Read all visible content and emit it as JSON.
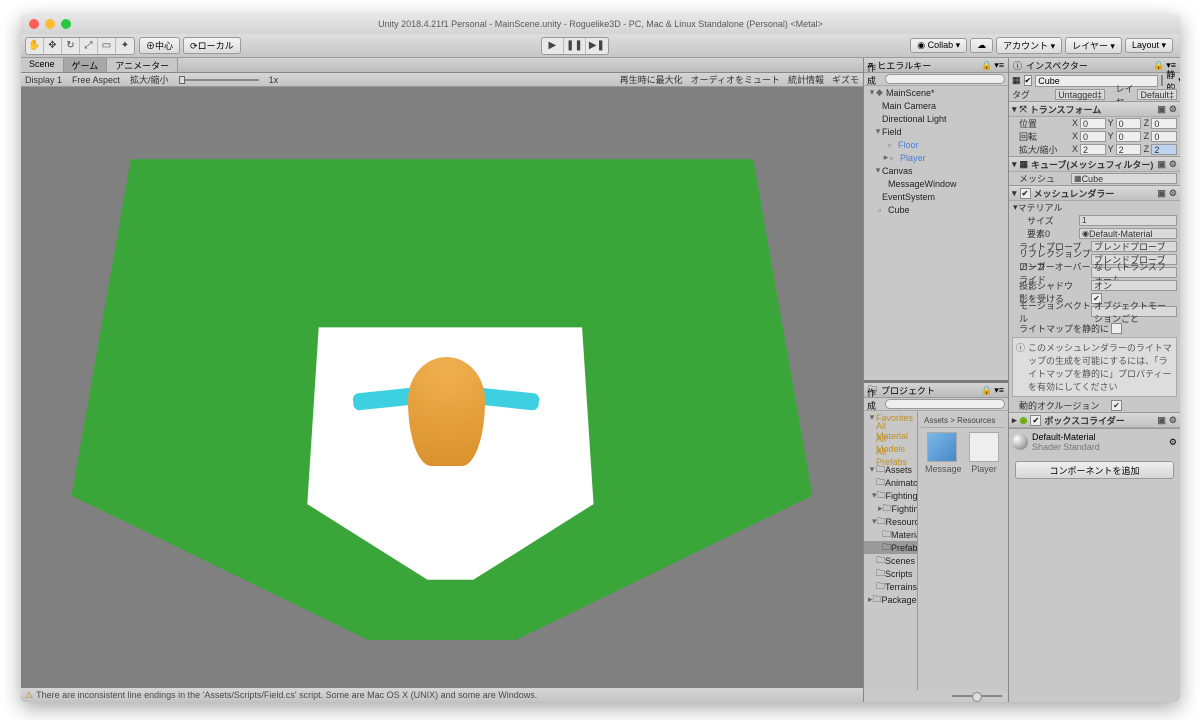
{
  "title": "Unity 2018.4.21f1 Personal - MainScene.unity - Roguelike3D - PC, Mac & Linux Standalone (Personal) <Metal>",
  "toolbar": {
    "center": "中心",
    "local": "ローカル",
    "collab": "Collab",
    "account": "アカウント",
    "layer": "レイヤー",
    "layout": "Layout"
  },
  "tabs": {
    "scene": "Scene",
    "game": "ゲーム",
    "animator": "アニメーター"
  },
  "gamebar": {
    "display": "Display 1",
    "aspect": "Free Aspect",
    "scale_label": "拡大/縮小",
    "scale_val": "1x",
    "maximize": "再生時に最大化",
    "mute": "オーディオをミュート",
    "stats": "統計情報",
    "gizmos": "ギズモ"
  },
  "status": "There are inconsistent line endings in the 'Assets/Scripts/Field.cs' script. Some are Mac OS X (UNIX) and some are Windows.",
  "hierarchy": {
    "title": "ヒエラルキー",
    "create": "作成",
    "scene": "MainScene*",
    "items": [
      "Main Camera",
      "Directional Light",
      "Field",
      "Floor",
      "Player",
      "Canvas",
      "MessageWindow",
      "EventSystem",
      "Cube"
    ]
  },
  "project": {
    "title": "プロジェクト",
    "create": "作成",
    "favorites": "Favorites",
    "fav_items": [
      "All Material",
      "All Models",
      "All Prefabs"
    ],
    "breadcrumb": "Assets > Resources",
    "tree": [
      "Assets",
      "AnimatorCo",
      "FightingUni",
      "FightingU",
      "Resources",
      "Materials",
      "Prefabs",
      "Scenes",
      "Scripts",
      "Terrains",
      "Packages"
    ],
    "assets": [
      {
        "name": "Message"
      },
      {
        "name": "Player"
      }
    ]
  },
  "inspector": {
    "title": "インスペクター",
    "name": "Cube",
    "static": "静的",
    "tag_label": "タグ",
    "tag": "Untagged",
    "layer_label": "レイヤー",
    "layer": "Default",
    "transform": {
      "title": "トランスフォーム",
      "pos": "位置",
      "rot": "回転",
      "scale": "拡大/縮小",
      "px": "0",
      "py": "0",
      "pz": "0",
      "rx": "0",
      "ry": "0",
      "rz": "0",
      "sx": "2",
      "sy": "2",
      "sz": "2"
    },
    "meshfilter": {
      "title": "キューブ(メッシュフィルター)",
      "mesh_label": "メッシュ",
      "mesh": "Cube"
    },
    "meshrenderer": {
      "title": "メッシュレンダラー",
      "materials": "マテリアル",
      "size_label": "サイズ",
      "size": "1",
      "elem": "要素0",
      "mat": "Default-Material",
      "lightprobe_label": "ライトプローブ",
      "lightprobe": "ブレンドプローブ",
      "reflprobe_label": "リフレクションプローブ",
      "reflprobe": "ブレンドプローブ",
      "anchor_label": "アンカーオーバーライド",
      "anchor": "なし（トランスフォーム",
      "castshadow_label": "投影シャドウ",
      "castshadow": "オン",
      "recvshadow_label": "影を受ける",
      "motion_label": "モーションベクトル",
      "motion": "オブジェクトモーションごと",
      "lmstatic_label": "ライトマップを静的に",
      "lmhelp": "このメッシュレンダラーのライトマップの生成を可能にするには、「ライトマップを静的に」プロパティーを有効にしてください",
      "dynocc_label": "動的オクルージョン"
    },
    "boxcollider": {
      "title": "ボックスコライダー"
    },
    "material": {
      "name": "Default-Material",
      "shader_label": "Shader",
      "shader": "Standard"
    },
    "add": "コンポーネントを追加"
  }
}
